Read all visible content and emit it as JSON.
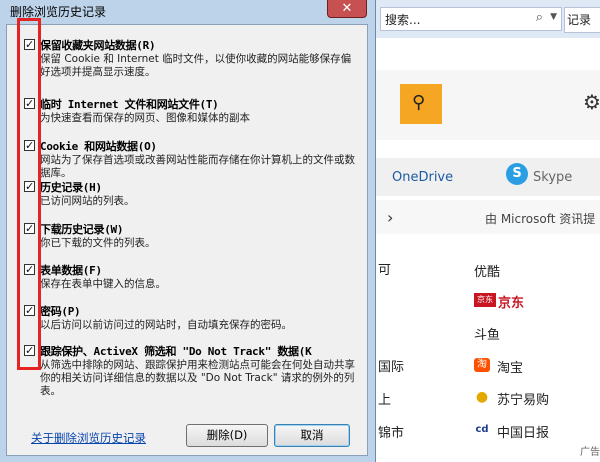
{
  "browser": {
    "search_text": "搜索...",
    "tab_text": "记录",
    "onedrive": "OneDrive",
    "skype": "Skype",
    "ms_news": "由 Microsoft 资讯提",
    "list_left": [
      "可",
      "国际",
      "上",
      "锦市"
    ],
    "list_right": [
      {
        "label": "优酷",
        "icon": "",
        "color": "#000000"
      },
      {
        "label": "京东",
        "icon": "京东",
        "color": "#c81623"
      },
      {
        "label": "斗鱼",
        "icon": "",
        "color": "#000000"
      },
      {
        "label": "淘宝",
        "icon": "淘",
        "color": "#ff5000"
      },
      {
        "label": "苏宁易购",
        "icon": "●",
        "color": "#e5a800"
      },
      {
        "label": "中国日报",
        "icon": "cd",
        "color": "#1a3c8c"
      }
    ],
    "ad": "广告"
  },
  "dialog": {
    "title": "删除浏览历史记录",
    "close_label": "✕",
    "options": [
      {
        "title": "保留收藏夹网站数据(R)",
        "desc": "保留 Cookie 和 Internet 临时文件，以使你收藏的网站能够保存偏好选项并提高显示速度。",
        "checked": true
      },
      {
        "title": "临时 Internet 文件和网站文件(T)",
        "desc": "为快速查看而保存的网页、图像和媒体的副本",
        "checked": true
      },
      {
        "title": "Cookie 和网站数据(O)",
        "desc": "网站为了保存首选项或改善网站性能而存储在你计算机上的文件或数据库。",
        "checked": true
      },
      {
        "title": "历史记录(H)",
        "desc": "已访问网站的列表。",
        "checked": true
      },
      {
        "title": "下载历史记录(W)",
        "desc": "你已下载的文件的列表。",
        "checked": true
      },
      {
        "title": "表单数据(F)",
        "desc": "保存在表单中键入的信息。",
        "checked": true
      },
      {
        "title": "密码(P)",
        "desc": "以后访问以前访问过的网站时，自动填充保存的密码。",
        "checked": true
      },
      {
        "title": "跟踪保护、ActiveX 筛选和 \"Do Not Track\" 数据(K",
        "desc": "从筛选中排除的网站、跟踪保护用来检测站点可能会在何处自动共享你的相关访问详细信息的数据以及 \"Do Not Track\" 请求的例外的列表。",
        "checked": true
      }
    ],
    "link": "关于删除浏览历史记录",
    "delete_button": "删除(D)",
    "cancel_button": "取消"
  },
  "colors": {
    "highlight_box": "#e52323",
    "close_button": "#c75050"
  }
}
